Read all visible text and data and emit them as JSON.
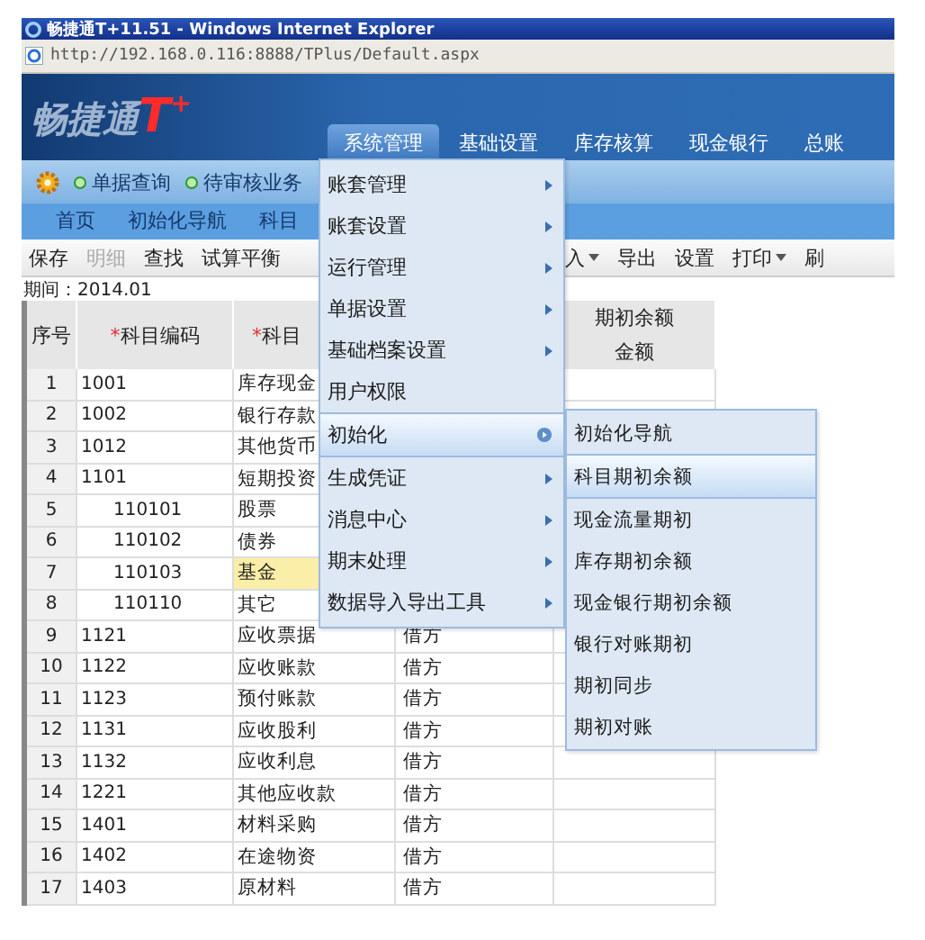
{
  "window": {
    "title": "畅捷通T+11.51 - Windows Internet Explorer"
  },
  "address_bar": {
    "url": "http://192.168.0.116:8888/TPlus/Default.aspx"
  },
  "header": {
    "logo_text": "畅捷通",
    "logo_mark": "T",
    "logo_plus": "+"
  },
  "nav_tabs": [
    {
      "label": "系统管理",
      "selected": true
    },
    {
      "label": "基础设置",
      "selected": false
    },
    {
      "label": "库存核算",
      "selected": false
    },
    {
      "label": "现金银行",
      "selected": false
    },
    {
      "label": "总账",
      "selected": false
    }
  ],
  "quick_links": [
    "单据查询",
    "待审核业务"
  ],
  "page_tabs": [
    {
      "label": "首页",
      "selected": false
    },
    {
      "label": "初始化导航",
      "selected": false
    },
    {
      "label": "科目",
      "selected": false
    }
  ],
  "toolbar": [
    {
      "label": "保存",
      "disabled": false,
      "dropdown": false
    },
    {
      "label": "明细",
      "disabled": true,
      "dropdown": false
    },
    {
      "label": "查找",
      "disabled": false,
      "dropdown": false
    },
    {
      "label": "试算平衡",
      "disabled": false,
      "dropdown": false
    },
    {
      "label": "入",
      "disabled": false,
      "dropdown": true
    },
    {
      "label": "导出",
      "disabled": false,
      "dropdown": false
    },
    {
      "label": "设置",
      "disabled": false,
      "dropdown": false
    },
    {
      "label": "打印",
      "disabled": false,
      "dropdown": true
    },
    {
      "label": "刷",
      "disabled": false,
      "dropdown": false
    }
  ],
  "period": "期间：2014.01",
  "table": {
    "columns": [
      {
        "label": "序号"
      },
      {
        "label": "科目编码",
        "marker": "*"
      },
      {
        "label": "科目",
        "marker": "*"
      }
    ],
    "group_header": "期初余额",
    "amount_header": "金额",
    "rows": [
      {
        "no": "1",
        "code": "1001",
        "name": "库存现金",
        "selected": false
      },
      {
        "no": "2",
        "code": "1002",
        "name": "银行存款",
        "selected": false
      },
      {
        "no": "3",
        "code": "1012",
        "name": "其他货币",
        "selected": false
      },
      {
        "no": "4",
        "code": "1101",
        "name": "短期投资",
        "selected": false,
        "children": [
          {
            "no": "5",
            "code": "110101",
            "name": "股票",
            "selected": false
          },
          {
            "no": "6",
            "code": "110102",
            "name": "债券",
            "selected": false
          },
          {
            "no": "7",
            "code": "110103",
            "name": "基金",
            "selected": true
          },
          {
            "no": "8",
            "code": "110110",
            "name": "其它",
            "selected": false
          }
        ]
      },
      {
        "no": "9",
        "code": "1121",
        "name": "应收票据",
        "direction": "借方",
        "selected": false
      },
      {
        "no": "10",
        "code": "1122",
        "name": "应收账款",
        "direction": "借方",
        "selected": false
      },
      {
        "no": "11",
        "code": "1123",
        "name": "预付账款",
        "direction": "借方",
        "selected": false
      },
      {
        "no": "12",
        "code": "1131",
        "name": "应收股利",
        "direction": "借方",
        "selected": false
      },
      {
        "no": "13",
        "code": "1132",
        "name": "应收利息",
        "direction": "借方",
        "selected": false
      },
      {
        "no": "14",
        "code": "1221",
        "name": "其他应收款",
        "direction": "借方",
        "selected": false
      },
      {
        "no": "15",
        "code": "1401",
        "name": "材料采购",
        "direction": "借方",
        "selected": false
      },
      {
        "no": "16",
        "code": "1402",
        "name": "在途物资",
        "direction": "借方",
        "selected": false
      },
      {
        "no": "17",
        "code": "1403",
        "name": "原材料",
        "direction": "借方",
        "selected": false
      }
    ]
  },
  "menu": {
    "items": [
      {
        "label": "账套管理",
        "has_submenu": true,
        "selected": false
      },
      {
        "label": "账套设置",
        "has_submenu": true,
        "selected": false
      },
      {
        "label": "运行管理",
        "has_submenu": true,
        "selected": false
      },
      {
        "label": "单据设置",
        "has_submenu": true,
        "selected": false
      },
      {
        "label": "基础档案设置",
        "has_submenu": true,
        "selected": false
      },
      {
        "label": "用户权限",
        "has_submenu": false,
        "selected": false
      },
      {
        "label": "初始化",
        "has_submenu": true,
        "selected": true
      },
      {
        "label": "生成凭证",
        "has_submenu": true,
        "selected": false
      },
      {
        "label": "消息中心",
        "has_submenu": true,
        "selected": false
      },
      {
        "label": "期末处理",
        "has_submenu": true,
        "selected": false
      },
      {
        "label": "数据导入导出工具",
        "has_submenu": true,
        "selected": false
      }
    ]
  },
  "submenu": {
    "items": [
      {
        "label": "初始化导航",
        "selected": false
      },
      {
        "label": "科目期初余额",
        "selected": true
      },
      {
        "label": "现金流量期初",
        "selected": false
      },
      {
        "label": "库存期初余额",
        "selected": false
      },
      {
        "label": "现金银行期初余额",
        "selected": false
      },
      {
        "label": "银行对账期初",
        "selected": false
      },
      {
        "label": "期初同步",
        "selected": false
      },
      {
        "label": "期初对账",
        "selected": false
      }
    ]
  }
}
